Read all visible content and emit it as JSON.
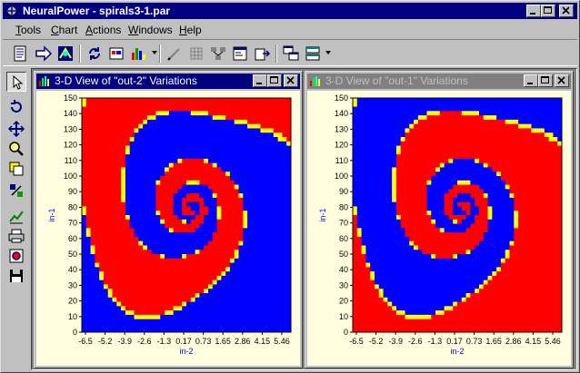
{
  "window": {
    "title": "NeuralPower - spirals3-1.par"
  },
  "menu": [
    {
      "label": "Tools",
      "key": "T",
      "rest": "ools"
    },
    {
      "label": "Chart",
      "key": "C",
      "rest": "hart"
    },
    {
      "label": "Actions",
      "key": "A",
      "rest": "ctions"
    },
    {
      "label": "Windows",
      "key": "W",
      "rest": "indows"
    },
    {
      "label": "Help",
      "key": "H",
      "rest": "elp"
    }
  ],
  "children": [
    {
      "title": "3-D View of \"out-2\" Variations",
      "active": true,
      "xlabel": "in-2",
      "ylabel": "in-1"
    },
    {
      "title": "3-D View of \"out-1\" Variations",
      "active": false,
      "xlabel": "in-2",
      "ylabel": "in-1"
    }
  ],
  "chart_data": [
    {
      "type": "heatmap",
      "title": "3-D View of \"out-2\" Variations",
      "xlabel": "in-2",
      "ylabel": "in-1",
      "xticks": [
        "-6.5",
        "-5.2",
        "-3.9",
        "-2.6",
        "-1.3",
        "0.17",
        "0.73",
        "1.65",
        "2.86",
        "4.15",
        "5.46"
      ],
      "yticks": [
        "0",
        "10",
        "20",
        "30",
        "40",
        "50",
        "60",
        "70",
        "80",
        "90",
        "100",
        "110",
        "120",
        "130",
        "140",
        "150"
      ],
      "ylim": [
        0,
        150
      ],
      "colors": {
        "low": "#0000ff",
        "high": "#ff0000",
        "edge": "#ffff00"
      }
    },
    {
      "type": "heatmap",
      "title": "3-D View of \"out-1\" Variations",
      "xlabel": "in-2",
      "ylabel": "in-1",
      "xticks": [
        "-6.5",
        "-5.2",
        "-3.9",
        "-2.6",
        "-1.3",
        "0.17",
        "0.73",
        "1.65",
        "2.86",
        "4.15",
        "5.46"
      ],
      "yticks": [
        "0",
        "10",
        "20",
        "30",
        "40",
        "50",
        "60",
        "70",
        "80",
        "90",
        "100",
        "110",
        "120",
        "130",
        "140",
        "150"
      ],
      "ylim": [
        0,
        150
      ],
      "colors": {
        "low": "#ff0000",
        "high": "#0000ff",
        "edge": "#ffff00"
      }
    }
  ]
}
